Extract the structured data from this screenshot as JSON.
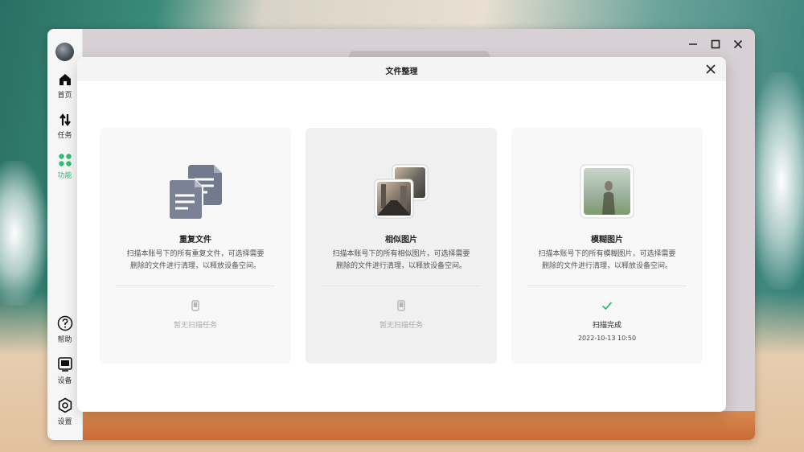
{
  "sidebar": {
    "items": [
      {
        "label": "首页",
        "icon": "home-icon"
      },
      {
        "label": "任务",
        "icon": "transfer-icon"
      },
      {
        "label": "功能",
        "icon": "apps-icon",
        "active": true
      },
      {
        "label": "帮助",
        "icon": "help-icon"
      },
      {
        "label": "设备",
        "icon": "device-icon"
      },
      {
        "label": "设置",
        "icon": "settings-icon"
      }
    ]
  },
  "dialog": {
    "title": "文件整理"
  },
  "cards": [
    {
      "title": "重复文件",
      "desc_line1": "扫描本账号下的所有重复文件，可选择需要",
      "desc_line2": "删除的文件进行清理，以释放设备空间。",
      "status": "暂无扫描任务",
      "time": ""
    },
    {
      "title": "相似图片",
      "desc_line1": "扫描本账号下的所有相似图片，可选择需要",
      "desc_line2": "删除的文件进行清理，以释放设备空间。",
      "status": "暂无扫描任务",
      "time": ""
    },
    {
      "title": "模糊图片",
      "desc_line1": "扫描本账号下的所有模糊图片，可选择需要",
      "desc_line2": "删除的文件进行清理，以释放设备空间。",
      "status": "扫描完成",
      "time": "2022-10-13 10:50"
    }
  ],
  "colors": {
    "accent_green": "#2fbd72",
    "icon_slate": "#737a8f"
  }
}
